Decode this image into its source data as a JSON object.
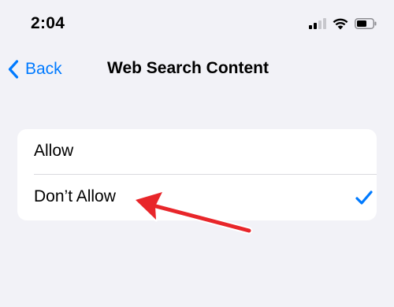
{
  "status_bar": {
    "time": "2:04",
    "icons": [
      "cellular-signal-icon",
      "wifi-icon",
      "battery-icon"
    ]
  },
  "nav": {
    "back_label": "Back",
    "title": "Web Search Content"
  },
  "options": [
    {
      "label": "Allow",
      "selected": false
    },
    {
      "label": "Don’t Allow",
      "selected": true
    }
  ],
  "colors": {
    "accent": "#007aff",
    "background": "#f2f2f7",
    "card": "#ffffff",
    "annotation_arrow": "#e8262a"
  }
}
